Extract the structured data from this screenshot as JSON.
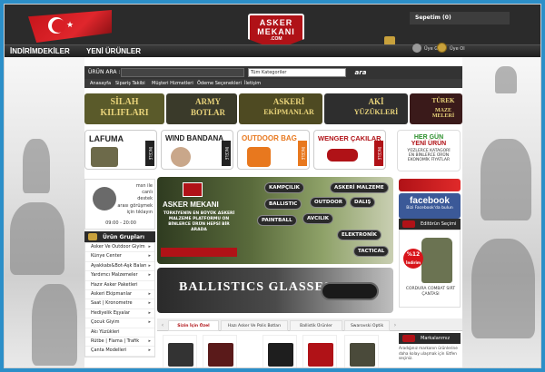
{
  "header": {
    "logo_line1": "ASKER",
    "logo_line2": "MEKANI",
    "logo_line3": ".COM",
    "cart": "Sepetim (0)",
    "nav": [
      "İNDİRİMDEKİLER",
      "YENİ ÜRÜNLER"
    ],
    "login": "Üye Girişi",
    "register": "Üye Ol"
  },
  "search": {
    "label": "ÜRÜN ARA :",
    "category_selected": "Tüm Kategoriler",
    "button": "ara"
  },
  "menu": [
    "Anasayfa",
    "Sipariş Takibi",
    "Müşteri Hizmetleri",
    "Ödeme Seçenekleri",
    "İletişim"
  ],
  "top_banners": [
    {
      "line1": "SİLAH",
      "line2": "KILIFLARI"
    },
    {
      "line1": "ARMY",
      "line2": "BOTLAR"
    },
    {
      "line1": "ASKERİ",
      "line2": "EKİPMANLAR"
    },
    {
      "line1": "AKİ",
      "line2": "YÜZÜKLERİ"
    },
    {
      "line1": "TÜREK",
      "line2": "MAZE MELERİ"
    }
  ],
  "category_tiles": [
    {
      "title": "LAFUMA",
      "tag": "İNCELE",
      "color": "#222222"
    },
    {
      "title": "WIND BANDANA",
      "tag": "İNCELE",
      "color": "#222222"
    },
    {
      "title": "OUTDOOR BAG",
      "tag": "İNCELE",
      "color": "#e8781e"
    },
    {
      "title": "WENGER ÇAKILAR",
      "tag": "İNCELE",
      "color": "#b01217"
    }
  ],
  "new_products": {
    "line1": "HER GÜN",
    "line2": "YENİ ÜRÜN",
    "line3": "YÜZLERCE KATAGORİ",
    "line4": "EN BİNLERCE ÜRÜN",
    "line5": "EKONOMİK FİYATLAR"
  },
  "promo": {
    "line1": "msn ile",
    "line2": "canlı",
    "line3": "destek",
    "line4": "arası görüşmek",
    "line5": "için tıklayın",
    "hours": "09:00 - 20:00"
  },
  "product_groups": {
    "title": "Ürün Grupları",
    "items": [
      {
        "label": "Asker Ve Outdoor Giyim",
        "arrow": true
      },
      {
        "label": "Künye Center",
        "arrow": true
      },
      {
        "label": "Ayakkabı&Bot-Aşk Baları",
        "arrow": true
      },
      {
        "label": "Yardımcı Malzemeler",
        "arrow": true
      },
      {
        "label": "Hazır Asker Paketleri",
        "arrow": false
      },
      {
        "label": "Askeri Ekipmanlar",
        "arrow": true
      },
      {
        "label": "Saat | Kronometre",
        "arrow": true
      },
      {
        "label": "Hediyelik Eşyalar",
        "arrow": true
      },
      {
        "label": "Çocuk Giyim",
        "arrow": true
      },
      {
        "label": "Akı Yüzükleri",
        "arrow": false
      },
      {
        "label": "Rütbe | Flama | Trafik",
        "arrow": true
      },
      {
        "label": "Çanta Modelleri",
        "arrow": true
      }
    ]
  },
  "hero": {
    "title": "ASKER MEKANI",
    "subtitle": "TÜRKİYENİN EN BÜYÜK ASKERİ MALZEME PLATFORMU ON BİNLERCE ÜRÜN HEPSİ BİR ARADA",
    "tags": [
      "KAMPÇILIK",
      "ASKERİ MALZEME",
      "BALLISTIC",
      "OUTDOOR",
      "DALIŞ",
      "PAINTBALL",
      "AVCILIK",
      "ELEKTRONİK",
      "TACTICAL"
    ]
  },
  "glasses": {
    "title": "BALLISTICS GLASSES"
  },
  "tabs": [
    {
      "label": "Sizin İçin Özel",
      "active": true
    },
    {
      "label": "Hazı Asker Ve Polis Botları",
      "active": false
    },
    {
      "label": "Ballistik Ürünler",
      "active": false
    },
    {
      "label": "Swarovski Optik",
      "active": false
    }
  ],
  "facebook": {
    "title": "facebook",
    "sub": "Bizi Facebook'da bulun"
  },
  "editor": {
    "title": "Editörün Seçimi",
    "discount": "%12",
    "discount_sub": "İndirim",
    "product": "CORDURA COMBAT SIRT ÇANTASI"
  },
  "markalar": {
    "title": "Markalarımız",
    "text": "Aradığınız markanın ürünlerine daha kolay ulaşmak için lütfen seçiniz."
  }
}
